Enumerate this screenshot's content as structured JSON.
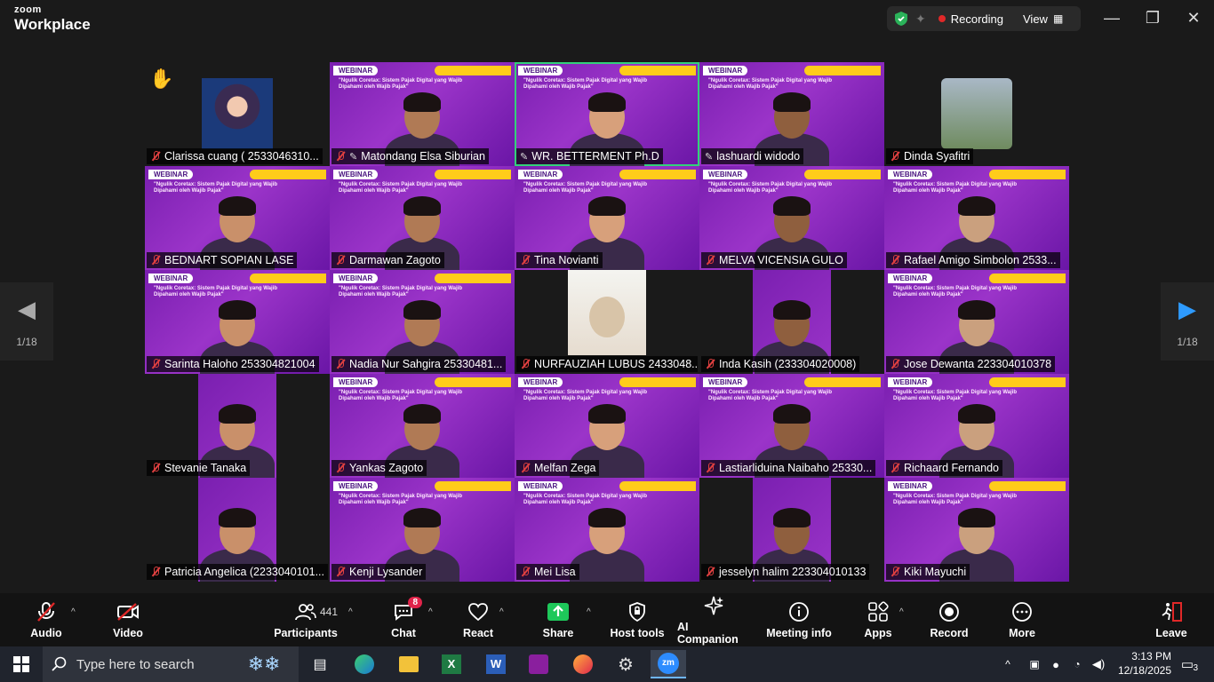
{
  "app": {
    "brand_small": "zoom",
    "brand_big": "Workplace"
  },
  "topbar": {
    "recording_label": "Recording",
    "view_label": "View"
  },
  "nav": {
    "page_left": "1/18",
    "page_right": "1/18"
  },
  "banner": {
    "webinar": "WEBINAR",
    "subtitle": "\"Ngulik Coretax: Sistem Pajak Digital yang Wajib Dipahami oleh Wajib Pajak\""
  },
  "participants": [
    {
      "name": "Clarissa cuang  ( 2533046310...",
      "kind": "avatar",
      "muted": true
    },
    {
      "name": "Matondang Elsa Siburian",
      "kind": "purple",
      "muted": true,
      "pinned": true
    },
    {
      "name": "WR. BETTERMENT Ph.D",
      "kind": "purple",
      "muted": false,
      "pinned": true,
      "active": true
    },
    {
      "name": "lashuardi widodo",
      "kind": "purple",
      "muted": false,
      "pinned": true
    },
    {
      "name": "Dinda Syafitri",
      "kind": "photo",
      "muted": true
    },
    {
      "name": "BEDNART SOPIAN LASE",
      "kind": "purple",
      "muted": true
    },
    {
      "name": "Darmawan Zagoto",
      "kind": "purple",
      "muted": true
    },
    {
      "name": "Tina Novianti",
      "kind": "purple",
      "muted": true
    },
    {
      "name": "MELVA VICENSIA GULO",
      "kind": "purple",
      "muted": true
    },
    {
      "name": "Rafael Amigo Simbolon 2533...",
      "kind": "purple",
      "muted": true
    },
    {
      "name": "Sarinta Haloho 253304821004",
      "kind": "purple",
      "muted": true
    },
    {
      "name": "Nadia Nur Sahgira 25330481...",
      "kind": "purple",
      "muted": true
    },
    {
      "name": "NURFAUZIAH LUBUS 2433048...",
      "kind": "narrow-light",
      "muted": true
    },
    {
      "name": "Inda Kasih (233304020008)",
      "kind": "narrow",
      "muted": true
    },
    {
      "name": "Jose Dewanta 223304010378",
      "kind": "purple",
      "muted": true
    },
    {
      "name": "Stevanie Tanaka",
      "kind": "narrow",
      "muted": true
    },
    {
      "name": "Yankas Zagoto",
      "kind": "purple",
      "muted": true
    },
    {
      "name": "Melfan Zega",
      "kind": "purple",
      "muted": true
    },
    {
      "name": "Lastiarliduina Naibaho 25330...",
      "kind": "purple",
      "muted": true
    },
    {
      "name": "Richaard Fernando",
      "kind": "purple",
      "muted": true
    },
    {
      "name": "Patricia Angelica (2233040101...",
      "kind": "narrow",
      "muted": true
    },
    {
      "name": "Kenji Lysander",
      "kind": "purple",
      "muted": true
    },
    {
      "name": "Mei Lisa",
      "kind": "purple",
      "muted": true
    },
    {
      "name": "jesselyn halim 223304010133",
      "kind": "narrow",
      "muted": true
    },
    {
      "name": "Kiki Mayuchi",
      "kind": "purple",
      "muted": true
    }
  ],
  "toolbar": {
    "audio": "Audio",
    "video": "Video",
    "participants": "Participants",
    "participant_count": "441",
    "chat": "Chat",
    "chat_badge": "8",
    "react": "React",
    "share": "Share",
    "host_tools": "Host tools",
    "ai_companion": "AI Companion",
    "meeting_info": "Meeting info",
    "apps": "Apps",
    "record": "Record",
    "more": "More",
    "leave": "Leave"
  },
  "taskbar": {
    "search_placeholder": "Type here to search",
    "time": "3:13 PM",
    "date": "12/18/2025",
    "notifications": "3"
  },
  "colors": {
    "accent_green": "#33d17a",
    "share_green": "#1ec85a",
    "leave_red": "#e02828",
    "tile_purple": "#8a26be"
  }
}
